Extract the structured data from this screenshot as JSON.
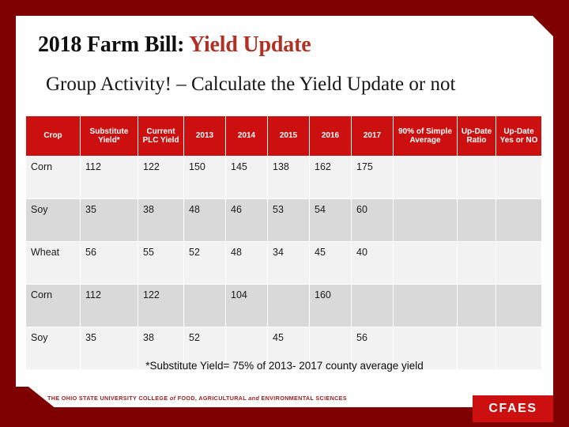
{
  "slide": {
    "title_black": "2018 Farm Bill: ",
    "title_red": "Yield Update",
    "subtitle": "Group Activity! – Calculate the Yield Update or not",
    "footnote": "*Substitute Yield= 75% of 2013- 2017 county average yield"
  },
  "colors": {
    "border_dark_red": "#7E0000",
    "header_red": "#CC1010",
    "title_red": "#B03024",
    "row_light": "#F2F2F2",
    "row_dark": "#D9D9D9",
    "osu_text_red": "#9E1B1B"
  },
  "table": {
    "headers": [
      "Crop",
      "Substitute Yield*",
      "Current PLC Yield",
      "2013",
      "2014",
      "2015",
      "2016",
      "2017",
      "90% of Simple Average",
      "Up-Date Ratio",
      "Up-Date Yes or NO"
    ],
    "rows": [
      {
        "crop": "Corn",
        "substitute_yield": "112",
        "current_plc_yield": "122",
        "y2013": "150",
        "y2014": "145",
        "y2015": "138",
        "y2016": "162",
        "y2017": "175",
        "ninety_simple_avg": "",
        "update_ratio": "",
        "update_yes_no": ""
      },
      {
        "crop": "Soy",
        "substitute_yield": "35",
        "current_plc_yield": "38",
        "y2013": "48",
        "y2014": "46",
        "y2015": "53",
        "y2016": "54",
        "y2017": "60",
        "ninety_simple_avg": "",
        "update_ratio": "",
        "update_yes_no": ""
      },
      {
        "crop": "Wheat",
        "substitute_yield": "56",
        "current_plc_yield": "55",
        "y2013": "52",
        "y2014": "48",
        "y2015": "34",
        "y2016": "45",
        "y2017": "40",
        "ninety_simple_avg": "",
        "update_ratio": "",
        "update_yes_no": ""
      },
      {
        "crop": "Corn",
        "substitute_yield": "112",
        "current_plc_yield": "122",
        "y2013": "",
        "y2014": "104",
        "y2015": "",
        "y2016": "160",
        "y2017": "",
        "ninety_simple_avg": "",
        "update_ratio": "",
        "update_yes_no": ""
      },
      {
        "crop": "Soy",
        "substitute_yield": "35",
        "current_plc_yield": "38",
        "y2013": "52",
        "y2014": "",
        "y2015": "45",
        "y2016": "",
        "y2017": "56",
        "ninety_simple_avg": "",
        "update_ratio": "",
        "update_yes_no": ""
      }
    ]
  },
  "footer": {
    "osu_part1": "THE OHIO STATE UNIVERSITY COLLEGE ",
    "osu_of": "of",
    "osu_part2": " FOOD, AGRICULTURAL ",
    "osu_and": "and",
    "osu_part3": " ENVIRONMENTAL SCIENCES",
    "cfaes_logo": "CFAES"
  }
}
